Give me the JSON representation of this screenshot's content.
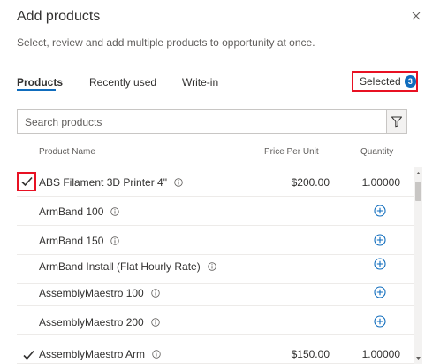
{
  "dialog": {
    "title": "Add products",
    "subtitle": "Select, review and add multiple products to opportunity at once."
  },
  "tabs": {
    "products": "Products",
    "recently_used": "Recently used",
    "write_in": "Write-in",
    "selected": "Selected",
    "selected_count": "3"
  },
  "search": {
    "placeholder": "Search products",
    "value": ""
  },
  "columns": {
    "name": "Product Name",
    "price": "Price Per Unit",
    "quantity": "Quantity"
  },
  "colors": {
    "accent": "#0f6cbd",
    "highlight": "#e81123"
  },
  "rows": [
    {
      "name": "ABS Filament 3D Printer 4\"",
      "price": "$200.00",
      "quantity": "1.00000",
      "selected": true
    },
    {
      "name": "ArmBand 100",
      "price": "",
      "quantity": "",
      "selected": false
    },
    {
      "name": "ArmBand 150",
      "price": "",
      "quantity": "",
      "selected": false
    },
    {
      "name": "ArmBand Install (Flat Hourly Rate)",
      "price": "",
      "quantity": "",
      "selected": false
    },
    {
      "name": "AssemblyMaestro 100",
      "price": "",
      "quantity": "",
      "selected": false
    },
    {
      "name": "AssemblyMaestro 200",
      "price": "",
      "quantity": "",
      "selected": false
    },
    {
      "name": "AssemblyMaestro Arm",
      "price": "$150.00",
      "quantity": "1.00000",
      "selected": true
    }
  ]
}
